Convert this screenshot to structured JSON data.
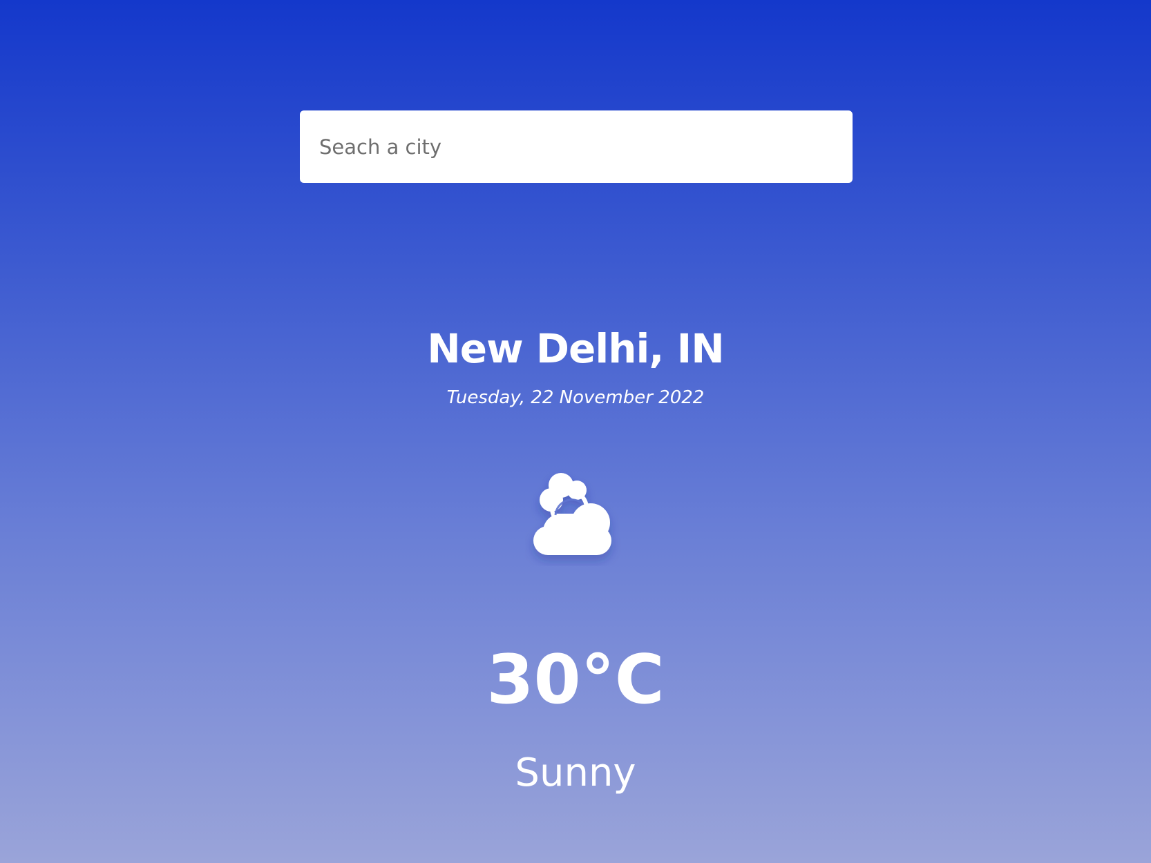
{
  "search": {
    "placeholder": "Seach a city",
    "value": ""
  },
  "location": {
    "city": "New Delhi, IN",
    "date": "Tuesday, 22 November 2022"
  },
  "weather": {
    "icon": "cloud-sun-icon",
    "temperature": "30°C",
    "condition": "Sunny"
  },
  "colors": {
    "background_top": "#1438cb",
    "background_bottom": "#9aa4d9",
    "text": "#ffffff",
    "search_bg": "#ffffff"
  }
}
